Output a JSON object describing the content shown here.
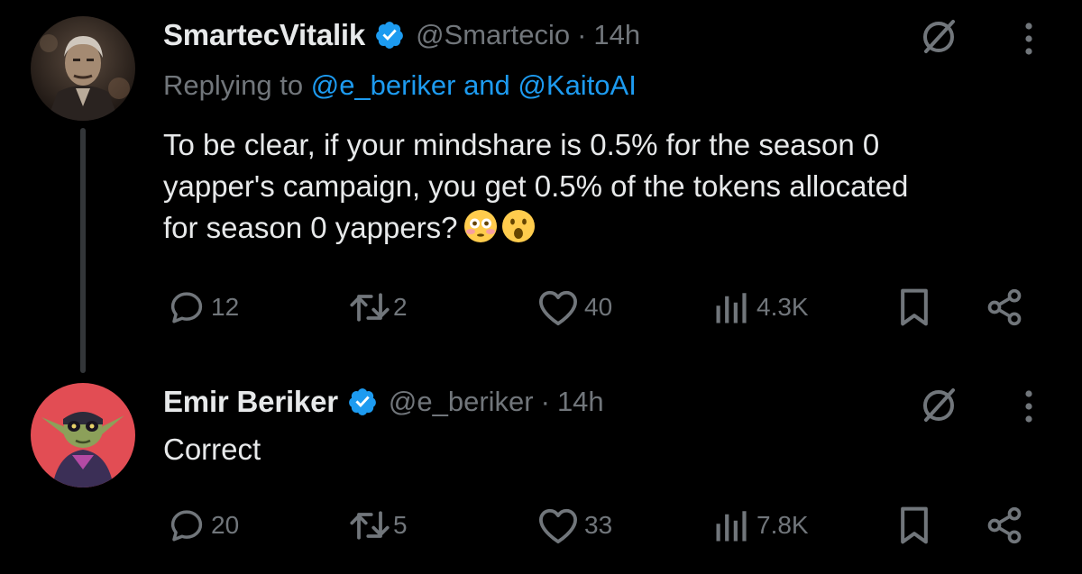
{
  "tweets": [
    {
      "author": {
        "name": "SmartecVitalik",
        "handle": "@Smartecio"
      },
      "time": "14h",
      "separator": "·",
      "reply": {
        "prefix": "Replying to",
        "user1": "@e_beriker",
        "joiner": "and",
        "user2": "@KaitoAI"
      },
      "text_lines": [
        "To be clear, if your mindshare is 0.5% for the season 0",
        "yapper's campaign,  you get 0.5% of the tokens allocated",
        "for season 0 yappers?"
      ],
      "emojis": [
        "flushed-face-emoji",
        "face-with-open-mouth-emoji"
      ],
      "stats": {
        "replies": "12",
        "reposts": "2",
        "likes": "40",
        "views": "4.3K"
      }
    },
    {
      "author": {
        "name": "Emir Beriker",
        "handle": "@e_beriker"
      },
      "time": "14h",
      "separator": "·",
      "text_lines": [
        "Correct"
      ],
      "stats": {
        "replies": "20",
        "reposts": "5",
        "likes": "33",
        "views": "7.8K"
      }
    }
  ],
  "icons": [
    "verified-badge-icon",
    "grok-icon",
    "more-icon",
    "reply-icon",
    "repost-icon",
    "like-icon",
    "views-icon",
    "bookmark-icon",
    "share-icon"
  ],
  "colors": {
    "background": "#000000",
    "text": "#e7e9ea",
    "muted": "#71767b",
    "accent": "#1d9bf0",
    "thread_line": "#333639"
  }
}
